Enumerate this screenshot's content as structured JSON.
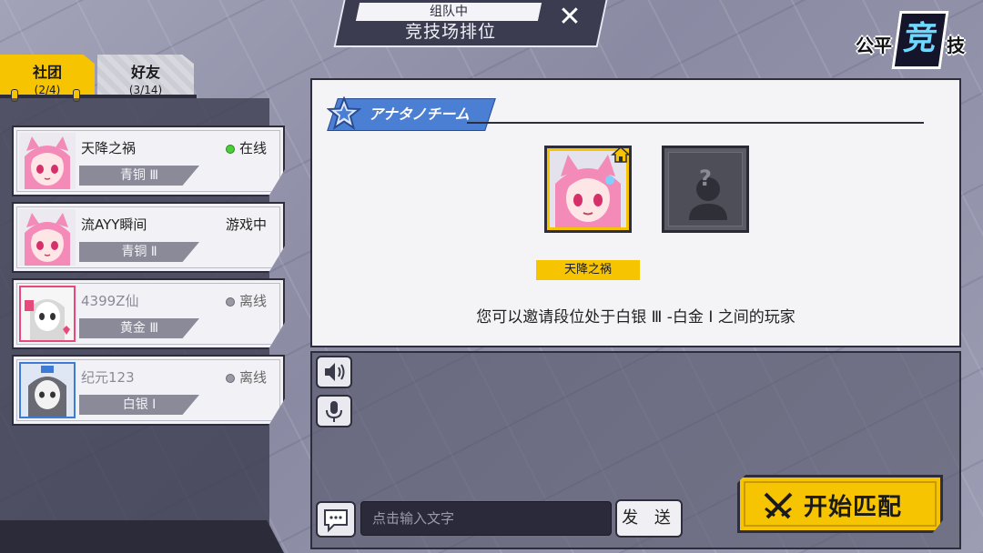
{
  "header": {
    "status": "组队中",
    "title": "竞技场排位",
    "logo_left": "公平",
    "logo_center": "竞",
    "logo_right": "技"
  },
  "tabs": [
    {
      "label": "社团",
      "count": "(2/4)",
      "active": true
    },
    {
      "label": "好友",
      "count": "(3/14)",
      "active": false
    }
  ],
  "members": [
    {
      "name": "天降之祸",
      "status": "在线",
      "status_dot": "green",
      "rank": "青铜 Ⅲ",
      "online": true
    },
    {
      "name": "流AYY瞬间",
      "status": "游戏中",
      "status_dot": "",
      "rank": "青铜 Ⅱ",
      "online": true
    },
    {
      "name": "4399Z仙",
      "status": "离线",
      "status_dot": "grey",
      "rank": "黄金 Ⅲ",
      "online": false
    },
    {
      "name": "纪元123",
      "status": "离线",
      "status_dot": "grey",
      "rank": "白银 Ⅰ",
      "online": false
    }
  ],
  "team": {
    "banner": "アナタノチーム",
    "leader_name": "天降之祸",
    "empty_slot": "?",
    "invite_hint": "您可以邀请段位处于白银 Ⅲ -白金 Ⅰ 之间的玩家"
  },
  "chat": {
    "input_placeholder": "点击输入文字",
    "send_label": "发 送"
  },
  "match_button": "开始匹配",
  "icons": {
    "close": "close-icon",
    "speaker": "speaker-icon",
    "microphone": "microphone-icon",
    "chat": "chat-bubble-icon",
    "swords": "crossed-swords-icon",
    "home": "house-icon",
    "star": "star-icon"
  },
  "colors": {
    "accent_yellow": "#f6c400",
    "team_blue": "#4b7fd4",
    "online_green": "#4ccd3a",
    "panel_dark": "#2d2d3c"
  }
}
